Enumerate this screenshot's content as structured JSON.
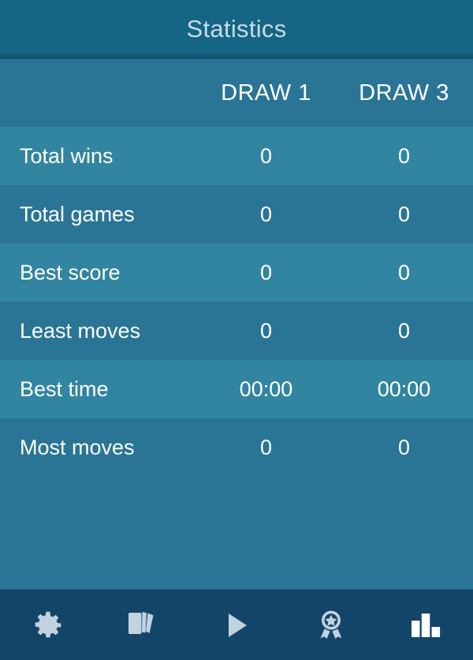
{
  "header": {
    "title": "Statistics"
  },
  "table": {
    "columns": [
      "",
      "DRAW 1",
      "DRAW 3"
    ],
    "rows": [
      {
        "label": "Total wins",
        "draw1": "0",
        "draw3": "0"
      },
      {
        "label": "Total games",
        "draw1": "0",
        "draw3": "0"
      },
      {
        "label": "Best score",
        "draw1": "0",
        "draw3": "0"
      },
      {
        "label": "Least moves",
        "draw1": "0",
        "draw3": "0"
      },
      {
        "label": "Best time",
        "draw1": "00:00",
        "draw3": "00:00"
      },
      {
        "label": "Most moves",
        "draw1": "0",
        "draw3": "0"
      }
    ]
  },
  "navbar": {
    "items": [
      {
        "icon": "gear-icon",
        "name": "settings",
        "active": false
      },
      {
        "icon": "cards-icon",
        "name": "decks",
        "active": false
      },
      {
        "icon": "play-icon",
        "name": "play",
        "active": false
      },
      {
        "icon": "award-icon",
        "name": "awards",
        "active": false
      },
      {
        "icon": "bar-chart-icon",
        "name": "statistics",
        "active": true
      }
    ]
  },
  "colors": {
    "titlebar": "#156684",
    "row_dark": "#2a7596",
    "row_light": "#3285a1",
    "navbar": "#134569",
    "title_text": "#c7dbe8",
    "text": "#ffffff",
    "icon_inactive": "#c0d3de",
    "icon_active": "#ffffff"
  }
}
